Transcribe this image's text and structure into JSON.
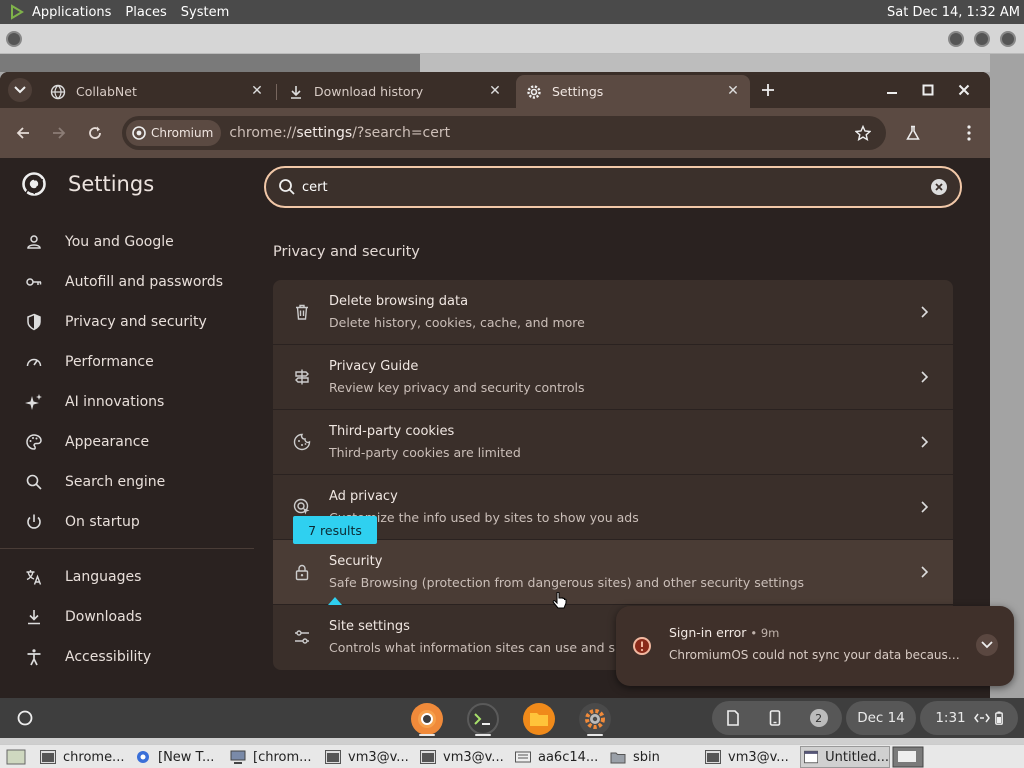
{
  "top_panel": {
    "menus": [
      "Applications",
      "Places",
      "System"
    ],
    "clock": "Sat Dec 14,  1:32 AM"
  },
  "tabs": [
    {
      "title": "CollabNet",
      "icon": "globe-icon"
    },
    {
      "title": "Download history",
      "icon": "download-icon"
    },
    {
      "title": "Settings",
      "icon": "gear-icon",
      "active": true
    }
  ],
  "toolbar": {
    "chip_label": "Chromium",
    "url_prefix": "chrome://",
    "url_host": "settings",
    "url_rest": "/?search=cert"
  },
  "settings": {
    "title": "Settings",
    "search_value": "cert",
    "nav": [
      {
        "label": "You and Google",
        "icon": "person-icon"
      },
      {
        "label": "Autofill and passwords",
        "icon": "key-icon"
      },
      {
        "label": "Privacy and security",
        "icon": "shield-icon"
      },
      {
        "label": "Performance",
        "icon": "speedometer-icon"
      },
      {
        "label": "AI innovations",
        "icon": "sparkle-icon"
      },
      {
        "label": "Appearance",
        "icon": "palette-icon"
      },
      {
        "label": "Search engine",
        "icon": "search-icon"
      },
      {
        "label": "On startup",
        "icon": "power-icon"
      }
    ],
    "nav2": [
      {
        "label": "Languages",
        "icon": "translate-icon"
      },
      {
        "label": "Downloads",
        "icon": "download-icon"
      },
      {
        "label": "Accessibility",
        "icon": "accessibility-icon"
      }
    ],
    "section_title": "Privacy and security",
    "rows": [
      {
        "title": "Delete browsing data",
        "subtitle": "Delete history, cookies, cache, and more",
        "icon": "trash-icon"
      },
      {
        "title": "Privacy Guide",
        "subtitle": "Review key privacy and security controls",
        "icon": "guide-icon"
      },
      {
        "title": "Third-party cookies",
        "subtitle": "Third-party cookies are limited",
        "icon": "cookie-icon"
      },
      {
        "title": "Ad privacy",
        "subtitle": "Customize the info used by sites to show you ads",
        "icon": "ad-privacy-icon"
      },
      {
        "title": "Security",
        "subtitle": "Safe Browsing (protection from dangerous sites) and other security settings",
        "icon": "lock-icon"
      },
      {
        "title": "Site settings",
        "subtitle": "Controls what information sites can use and show",
        "icon": "sliders-icon"
      }
    ],
    "results_bubble": "7 results"
  },
  "notification": {
    "title": "Sign-in error",
    "time": "• 9m",
    "body": "ChromiumOS could not sync your data because your account sign-in details are out of date."
  },
  "shelf": {
    "badge_count": "2",
    "date": "Dec 14",
    "time": "1:31"
  },
  "taskbar": [
    "chrome...",
    "[New T...",
    "[chrom...",
    "vm3@v...",
    "vm3@v...",
    "aa6c14...",
    "sbin",
    "vm3@v...",
    "Untitled..."
  ]
}
